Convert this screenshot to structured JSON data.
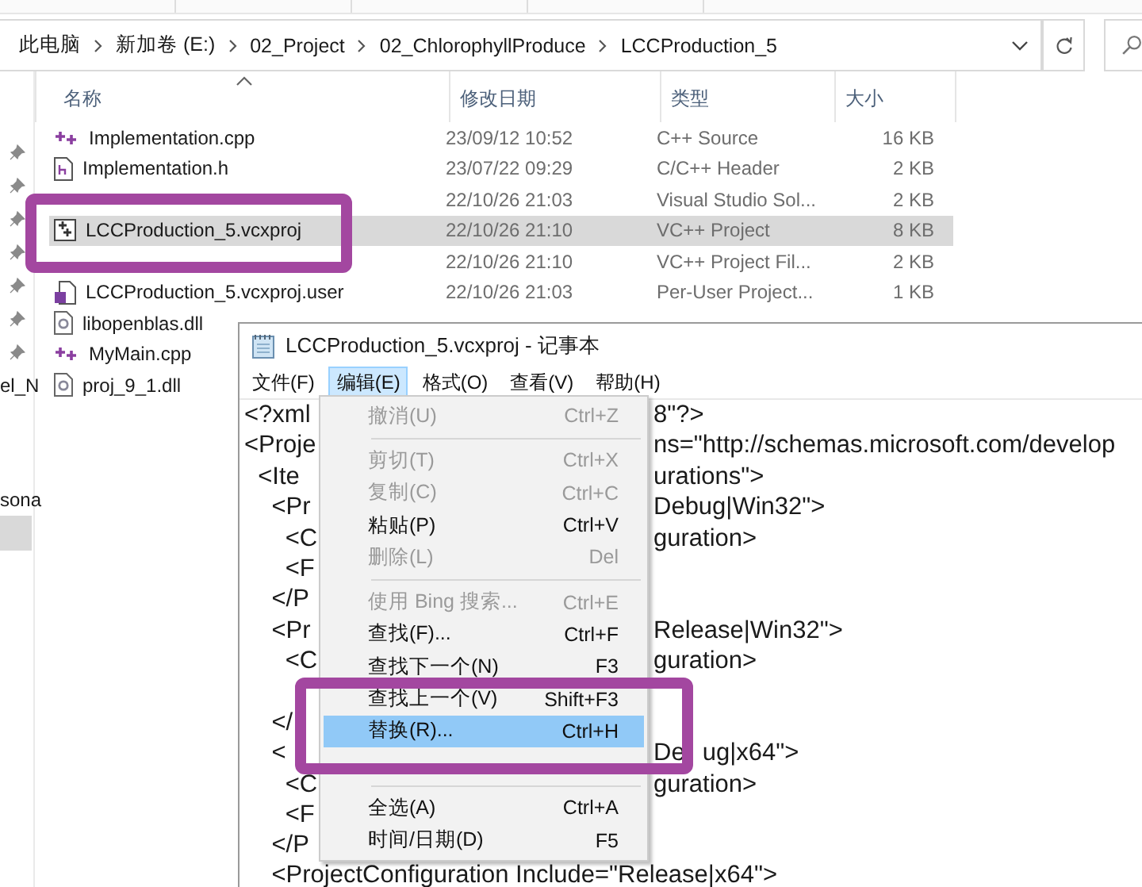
{
  "explorer": {
    "breadcrumb": [
      "此电脑",
      "新加卷 (E:)",
      "02_Project",
      "02_ChlorophyllProduce",
      "LCCProduction_5"
    ],
    "columns": [
      {
        "label": "名称",
        "sorted": true
      },
      {
        "label": "修改日期",
        "sorted": false
      },
      {
        "label": "类型",
        "sorted": false
      },
      {
        "label": "大小",
        "sorted": false
      }
    ],
    "nav_items": [
      {
        "label": "el_N",
        "selected": false
      },
      {
        "label": "sona",
        "selected": false
      },
      {
        "selected": true
      }
    ],
    "rows": [
      {
        "kind": "cpp",
        "name": "Implementation.cpp",
        "date": "23/09/12 10:52",
        "type": "C++ Source",
        "size": "16 KB",
        "selected": false
      },
      {
        "kind": "h",
        "name": "Implementation.h",
        "date": "23/07/22 09:29",
        "type": "C/C++ Header",
        "size": "2 KB",
        "selected": false
      },
      {
        "kind": "hidden",
        "date": "22/10/26 21:03",
        "type": "Visual Studio Sol...",
        "size": "2 KB",
        "selected": false
      },
      {
        "kind": "vcxproj",
        "name": "LCCProduction_5.vcxproj",
        "date": "22/10/26 21:10",
        "type": "VC++ Project",
        "size": "8 KB",
        "selected": true
      },
      {
        "kind": "hidden",
        "date": "22/10/26 21:10",
        "type": "VC++ Project Fil...",
        "size": "2 KB",
        "selected": false
      },
      {
        "kind": "user",
        "name": "LCCProduction_5.vcxproj.user",
        "date": "22/10/26 21:03",
        "type": "Per-User Project...",
        "size": "1 KB",
        "selected": false
      },
      {
        "kind": "dll",
        "name": "libopenblas.dll",
        "selected": false
      },
      {
        "kind": "cpp",
        "name": "MyMain.cpp",
        "selected": false
      },
      {
        "kind": "dll",
        "name": "proj_9_1.dll",
        "selected": false
      }
    ]
  },
  "notepad": {
    "title": "LCCProduction_5.vcxproj - 记事本",
    "menus": [
      {
        "label": "文件(F)",
        "selected": false
      },
      {
        "label": "编辑(E)",
        "selected": true
      },
      {
        "label": "格式(O)",
        "selected": false
      },
      {
        "label": "查看(V)",
        "selected": false
      },
      {
        "label": "帮助(H)",
        "selected": false
      }
    ],
    "lines": [
      {
        "kind": "code",
        "left": "<?xml",
        "right": [
          "8\"?>"
        ]
      },
      {
        "kind": "code",
        "left": "<Proje",
        "right": [
          "ns=\"http://schemas.microsoft.com/develop"
        ]
      },
      {
        "kind": "code",
        "left": "  <Ite",
        "right": [
          "urations\">"
        ]
      },
      {
        "kind": "code",
        "left": "    <Pr",
        "right": [
          "Debug|Win32\">"
        ]
      },
      {
        "kind": "code",
        "left": "      <C",
        "right": [
          "guration>"
        ]
      },
      {
        "kind": "code",
        "left": "      <F"
      },
      {
        "kind": "code",
        "left": "    </P"
      },
      {
        "kind": "code",
        "left": "    <Pr",
        "right": [
          "Release|Win32\">"
        ]
      },
      {
        "kind": "code",
        "left": "      <C",
        "right": [
          "guration>"
        ]
      },
      {
        "kind": "covered"
      },
      {
        "kind": "code",
        "left": "    </"
      },
      {
        "kind": "code",
        "left": "    <",
        "right": [
          "De",
          "ug|x64\">"
        ]
      },
      {
        "kind": "code",
        "left": "      <C",
        "right": [
          "guration>"
        ]
      },
      {
        "kind": "code",
        "left": "      <F"
      },
      {
        "kind": "code",
        "left": "    </P"
      },
      {
        "kind": "code",
        "left": "    <ProjectConfiguration Include=\"Release|x64\">"
      }
    ],
    "edit_menu": [
      {
        "kind": "item",
        "label": "撤消(U)",
        "shortcut": "Ctrl+Z",
        "disabled": true,
        "selected": false
      },
      {
        "kind": "separator"
      },
      {
        "kind": "item",
        "label": "剪切(T)",
        "shortcut": "Ctrl+X",
        "disabled": true,
        "selected": false
      },
      {
        "kind": "item",
        "label": "复制(C)",
        "shortcut": "Ctrl+C",
        "disabled": true,
        "selected": false
      },
      {
        "kind": "item",
        "label": "粘贴(P)",
        "shortcut": "Ctrl+V",
        "disabled": false,
        "selected": false
      },
      {
        "kind": "item",
        "label": "删除(L)",
        "shortcut": "Del",
        "disabled": true,
        "selected": false
      },
      {
        "kind": "separator"
      },
      {
        "kind": "item",
        "label": "使用 Bing 搜索...",
        "shortcut": "Ctrl+E",
        "disabled": true,
        "selected": false
      },
      {
        "kind": "item",
        "label": "查找(F)...",
        "shortcut": "Ctrl+F",
        "disabled": false,
        "selected": false
      },
      {
        "kind": "item",
        "label": "查找下一个(N)",
        "shortcut": "F3",
        "disabled": false,
        "selected": false
      },
      {
        "kind": "item",
        "label": "查找上一个(V)",
        "shortcut": "Shift+F3",
        "disabled": false,
        "selected": false
      },
      {
        "kind": "item",
        "label": "替换(R)...",
        "shortcut": "Ctrl+H",
        "disabled": false,
        "selected": true
      },
      {
        "kind": "covered"
      },
      {
        "kind": "separator"
      },
      {
        "kind": "item",
        "label": "全选(A)",
        "shortcut": "Ctrl+A",
        "disabled": false,
        "selected": false
      },
      {
        "kind": "item",
        "label": "时间/日期(D)",
        "shortcut": "F5",
        "disabled": false,
        "selected": false
      }
    ]
  },
  "annotations": [
    {
      "kind": "frame",
      "color": "#a347a0"
    },
    {
      "kind": "frame",
      "color": "#a347a0"
    }
  ]
}
